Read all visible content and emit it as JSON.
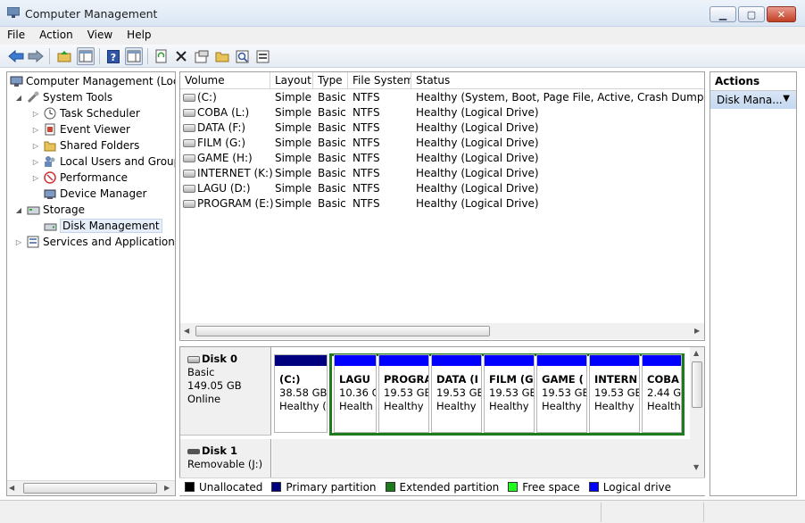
{
  "window": {
    "title": "Computer Management"
  },
  "menu": [
    "File",
    "Action",
    "View",
    "Help"
  ],
  "tree": {
    "root": "Computer Management (Local)",
    "system_tools": "System Tools",
    "items": [
      "Task Scheduler",
      "Event Viewer",
      "Shared Folders",
      "Local Users and Groups",
      "Performance",
      "Device Manager"
    ],
    "storage": "Storage",
    "disk_management": "Disk Management",
    "services": "Services and Applications"
  },
  "volume_table": {
    "columns": [
      "Volume",
      "Layout",
      "Type",
      "File System",
      "Status"
    ],
    "rows": [
      [
        "(C:)",
        "Simple",
        "Basic",
        "NTFS",
        "Healthy (System, Boot, Page File, Active, Crash Dump, Primary Partition)"
      ],
      [
        "COBA (L:)",
        "Simple",
        "Basic",
        "NTFS",
        "Healthy (Logical Drive)"
      ],
      [
        "DATA (F:)",
        "Simple",
        "Basic",
        "NTFS",
        "Healthy (Logical Drive)"
      ],
      [
        "FILM (G:)",
        "Simple",
        "Basic",
        "NTFS",
        "Healthy (Logical Drive)"
      ],
      [
        "GAME (H:)",
        "Simple",
        "Basic",
        "NTFS",
        "Healthy (Logical Drive)"
      ],
      [
        "INTERNET (K:)",
        "Simple",
        "Basic",
        "NTFS",
        "Healthy (Logical Drive)"
      ],
      [
        "LAGU (D:)",
        "Simple",
        "Basic",
        "NTFS",
        "Healthy (Logical Drive)"
      ],
      [
        "PROGRAM (E:)",
        "Simple",
        "Basic",
        "NTFS",
        "Healthy (Logical Drive)"
      ]
    ]
  },
  "disks": {
    "disk0": {
      "name": "Disk 0",
      "type": "Basic",
      "size": "149.05 GB",
      "state": "Online"
    },
    "disk1": {
      "name": "Disk 1",
      "type": "Removable (J:)"
    }
  },
  "partitions": [
    {
      "name": "(C:)",
      "size": "38.58 GB",
      "status": "Healthy (",
      "kind": "primary"
    },
    {
      "name": "LAGU",
      "size": "10.36 G",
      "status": "Health",
      "kind": "logical"
    },
    {
      "name": "PROGRA",
      "size": "19.53 GB",
      "status": "Healthy",
      "kind": "logical"
    },
    {
      "name": "DATA (I",
      "size": "19.53 GE",
      "status": "Healthy",
      "kind": "logical"
    },
    {
      "name": "FILM (G",
      "size": "19.53 GE",
      "status": "Healthy",
      "kind": "logical"
    },
    {
      "name": "GAME (",
      "size": "19.53 GE",
      "status": "Healthy",
      "kind": "logical"
    },
    {
      "name": "INTERN",
      "size": "19.53 GE",
      "status": "Healthy",
      "kind": "logical"
    },
    {
      "name": "COBA",
      "size": "2.44 G",
      "status": "Health",
      "kind": "logical"
    }
  ],
  "legend": [
    {
      "label": "Unallocated",
      "color": "#000000"
    },
    {
      "label": "Primary partition",
      "color": "#00007f"
    },
    {
      "label": "Extended partition",
      "color": "#1d7a1d"
    },
    {
      "label": "Free space",
      "color": "#1eff1e"
    },
    {
      "label": "Logical drive",
      "color": "#0000ff"
    }
  ],
  "actions": {
    "title": "Actions",
    "sub": "Disk Mana..."
  },
  "colors": {
    "primary": "#00007f",
    "logical": "#0000ff",
    "extended": "#1d7a1d"
  },
  "icons": [
    "app-icon",
    "back-icon",
    "forward-icon",
    "up-folder-icon",
    "show-tree-icon",
    "help-icon",
    "refresh-icon",
    "delete-icon",
    "properties-icon",
    "open-icon",
    "search-icon",
    "export-icon"
  ]
}
